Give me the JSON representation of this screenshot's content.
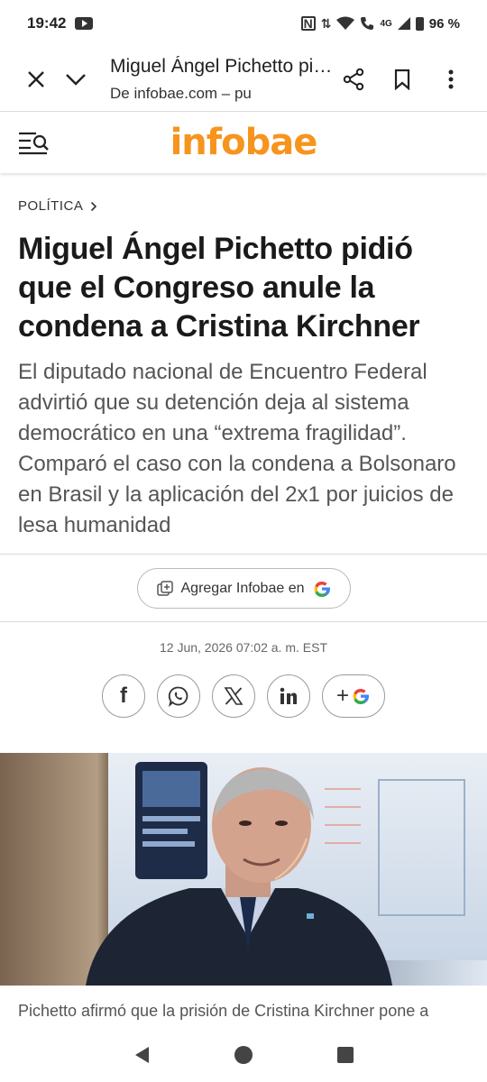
{
  "status": {
    "time": "19:42",
    "network": "4G",
    "battery": "96 %"
  },
  "tab": {
    "title": "Miguel Ángel Pichetto pidió que el Congreso anule la condena a Cristina Kirchner",
    "url": "De infobae.com – pu"
  },
  "site": {
    "logo": "infobae",
    "brand_color": "#f7941d"
  },
  "article": {
    "section": "POLÍTICA",
    "headline": "Miguel Ángel Pichetto pidió que el Congreso anule la condena a Cristina Kirchner",
    "subhead": "El diputado nacional de Encuentro Federal advirtió que su detención deja al sistema democrático en una “extrema fragilidad”. Comparó el caso con la condena a Bolsonaro en Brasil y la aplicación del 2x1 por juicios de lesa humanidad",
    "add_source_label": "Agregar Infobae en",
    "date": "12 Jun, 2026 07:02 a. m. EST",
    "share": {
      "facebook": "f",
      "plus_g": "+"
    },
    "caption": "Pichetto afirmó que la prisión de Cristina Kirchner pone a"
  }
}
